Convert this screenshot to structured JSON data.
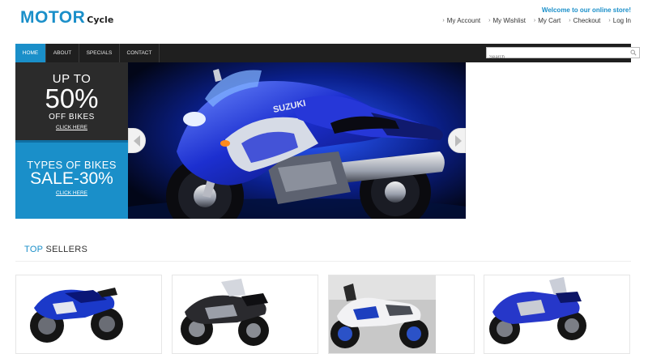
{
  "header": {
    "logo_main": "MOTOR",
    "logo_sub": "Cycle",
    "welcome": "Welcome to our online store!",
    "links": [
      "My Account",
      "My Wishlist",
      "My Cart",
      "Checkout",
      "Log In"
    ]
  },
  "nav": {
    "items": [
      "HOME",
      "ABOUT",
      "SPECIALS",
      "CONTACT"
    ],
    "active": "HOME",
    "search_placeholder": "Search"
  },
  "promos": {
    "first": {
      "line1": "UP TO",
      "line2": "50%",
      "line3": "OFF BIKES",
      "link": "CLICK HERE"
    },
    "second": {
      "line1": "TYPES OF BIKES",
      "line2": "SALE-30%",
      "link": "CLICK HERE"
    }
  },
  "banner": {
    "brand_text": "SUZUKI"
  },
  "top_sellers": {
    "title_accent": "TOP",
    "title_rest": " SELLERS"
  },
  "colors": {
    "accent": "#1a8fc9",
    "nav_bg": "#1f1f1f",
    "promo_dark": "#2b2b2b"
  }
}
